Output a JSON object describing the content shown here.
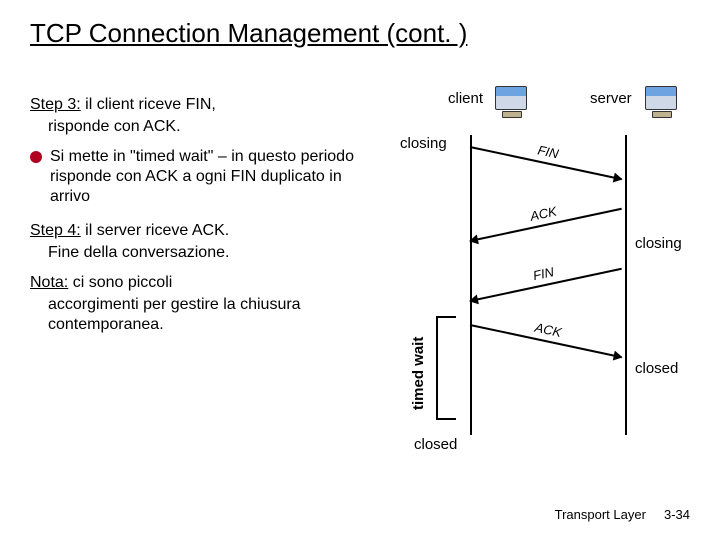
{
  "title": "TCP Connection Management (cont. )",
  "step3": {
    "heading_u": "Step 3:",
    "heading_rest": " il client riceve FIN,",
    "body": "risponde con ACK.",
    "bullet": "Si mette in \"timed wait\" – in questo periodo risponde con ACK a ogni FIN duplicato in arrivo"
  },
  "step4": {
    "heading_u": "Step 4:",
    "heading_rest": " il server riceve ACK.",
    "body": "Fine della conversazione."
  },
  "nota": {
    "heading_u": "Nota:",
    "heading_rest": " ci sono piccoli",
    "body": "accorgimenti per gestire la chiusura contemporanea."
  },
  "diagram": {
    "client_label": "client",
    "server_label": "server",
    "closing_client": "closing",
    "closing_server": "closing",
    "closed_server": "closed",
    "closed_client": "closed",
    "timed_wait": "timed wait",
    "messages": {
      "fin1": "FIN",
      "ack1": "ACK",
      "fin2": "FIN",
      "ack2": "ACK"
    }
  },
  "footer": {
    "layer": "Transport Layer",
    "page": "3-34"
  }
}
